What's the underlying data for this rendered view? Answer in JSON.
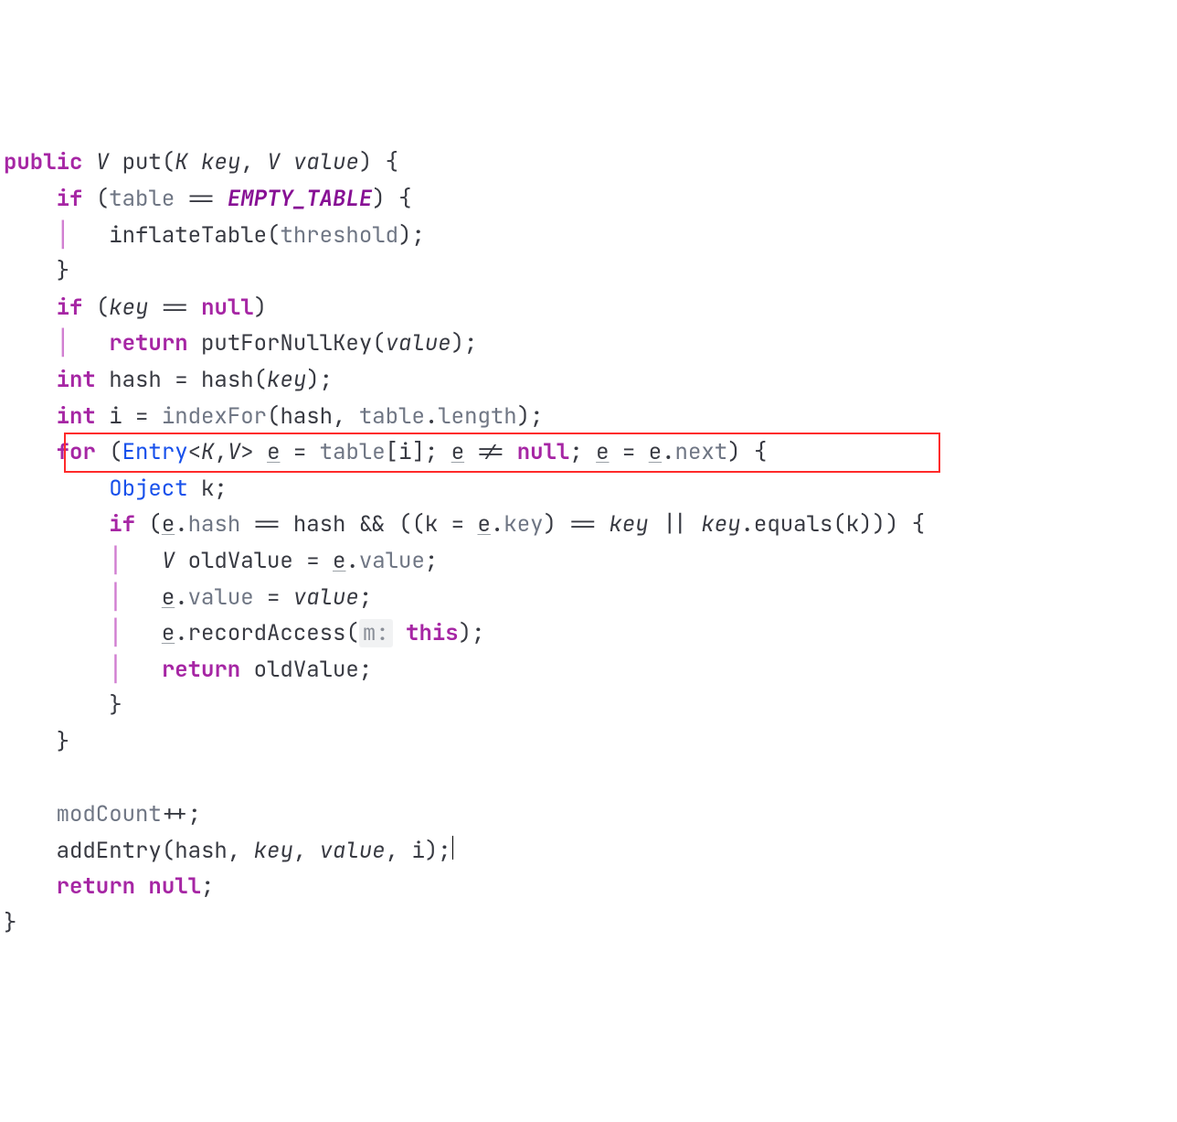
{
  "code": {
    "sig": {
      "public": "public",
      "V": "V",
      "put": "put",
      "K": "K",
      "key": "key",
      "value": "value"
    },
    "l2": {
      "if": "if",
      "table": "table",
      "eq": "==",
      "EMPTY": "EMPTY_TABLE"
    },
    "l3": {
      "inflate": "inflateTable",
      "threshold": "threshold"
    },
    "l5": {
      "if": "if",
      "key": "key",
      "eq": "==",
      "null": "null"
    },
    "l6": {
      "return": "return",
      "putFor": "putForNullKey",
      "value": "value"
    },
    "l7": {
      "int": "int",
      "hash": "hash",
      "hashFn": "hash",
      "key": "key"
    },
    "l8": {
      "int": "int",
      "i": "i",
      "indexFor": "indexFor",
      "hash": "hash",
      "table": "table",
      "length": "length"
    },
    "l9": {
      "for": "for",
      "Entry": "Entry",
      "K": "K",
      "V": "V",
      "e": "e",
      "table": "table",
      "i": "i",
      "null": "null",
      "next": "next"
    },
    "l10": {
      "Object": "Object",
      "k": "k"
    },
    "l11": {
      "if": "if",
      "e": "e",
      "hash": "hash",
      "k": "k",
      "key": "key",
      "equals": "equals"
    },
    "l12": {
      "V": "V",
      "oldValue": "oldValue",
      "e": "e",
      "value": "value"
    },
    "l13": {
      "e": "e",
      "value": "value",
      "valueP": "value"
    },
    "l14": {
      "e": "e",
      "recordAccess": "recordAccess",
      "hint": "m:",
      "this": "this"
    },
    "l15": {
      "return": "return",
      "oldValue": "oldValue"
    },
    "l18": {
      "modCount": "modCount"
    },
    "l19": {
      "addEntry": "addEntry",
      "hash": "hash",
      "key": "key",
      "value": "value",
      "i": "i"
    },
    "l20": {
      "return": "return",
      "null": "null"
    }
  }
}
